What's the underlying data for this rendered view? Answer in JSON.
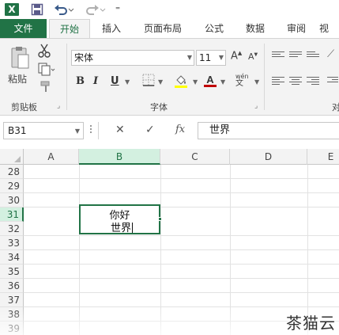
{
  "app": {
    "logo_letter": "X"
  },
  "qat": {
    "customize_symbol": "⁼"
  },
  "tabs": [
    {
      "label": "文件"
    },
    {
      "label": "开始"
    },
    {
      "label": "插入"
    },
    {
      "label": "页面布局"
    },
    {
      "label": "公式"
    },
    {
      "label": "数据"
    },
    {
      "label": "审阅"
    },
    {
      "label": "视"
    }
  ],
  "ribbon": {
    "clipboard": {
      "paste_label": "粘贴",
      "group_label": "剪贴板"
    },
    "font": {
      "font_name": "宋体",
      "font_size": "11",
      "grow_label": "A",
      "shrink_label": "A",
      "bold_label": "B",
      "italic_label": "I",
      "underline_label": "U",
      "phonetic_label": "wén",
      "group_label": "字体"
    },
    "alignment": {
      "group_label_partial": "对"
    }
  },
  "formula_bar": {
    "name_box": "B31",
    "cancel_symbol": "✕",
    "enter_symbol": "✓",
    "fx_label": "fx",
    "content": "世界"
  },
  "grid": {
    "columns": [
      "A",
      "B",
      "C",
      "D",
      "E"
    ],
    "active_column": "B",
    "rows": [
      "28",
      "29",
      "30",
      "31",
      "32",
      "33",
      "34",
      "35",
      "36",
      "37",
      "38",
      "39"
    ],
    "active_row": "31",
    "active_cell": {
      "ref": "B31",
      "line1": "你好",
      "line2": "世界"
    }
  },
  "watermark": "茶猫云",
  "colors": {
    "accent": "#217346",
    "ribbon_bg": "#f3f3f3",
    "font_color_bar": "#c00000"
  }
}
